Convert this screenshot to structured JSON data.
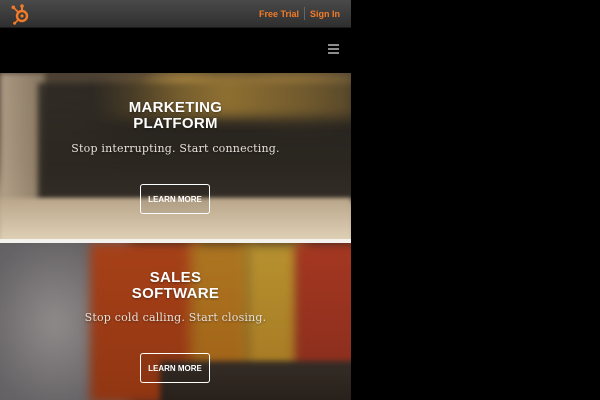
{
  "header": {
    "logo_icon": "hubspot-sprocket-icon",
    "free_trial_label": "Free Trial",
    "sign_in_label": "Sign In",
    "link_color": "#f37b28"
  },
  "nav": {
    "menu_icon": "hamburger-menu-icon"
  },
  "panels": [
    {
      "title_line1": "MARKETING",
      "title_line2": "PLATFORM",
      "tagline": "Stop interrupting. Start connecting.",
      "button_label": "LEARN MORE"
    },
    {
      "title_line1": "SALES",
      "title_line2": "SOFTWARE",
      "tagline": "Stop cold calling. Start closing.",
      "button_label": "LEARN MORE"
    }
  ]
}
